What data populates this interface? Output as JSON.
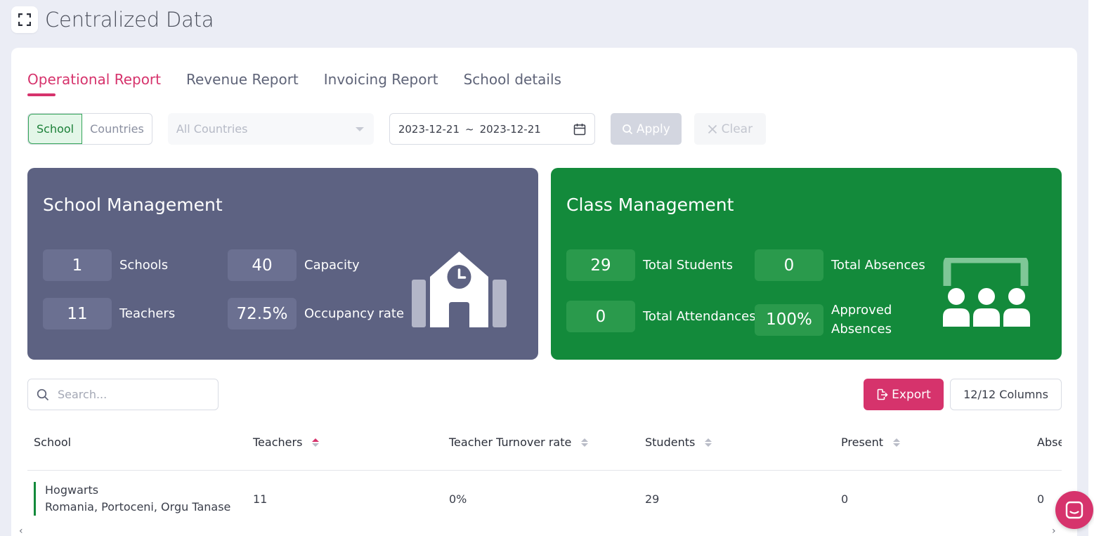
{
  "header": {
    "title": "Centralized Data"
  },
  "tabs": [
    {
      "label": "Operational Report",
      "active": true
    },
    {
      "label": "Revenue Report",
      "active": false
    },
    {
      "label": "Invoicing Report",
      "active": false
    },
    {
      "label": "School details",
      "active": false
    }
  ],
  "filters": {
    "segment": {
      "school": "School",
      "countries": "Countries",
      "selected": "School"
    },
    "country_select": {
      "value": "All Countries"
    },
    "date_range": {
      "start": "2023-12-21",
      "separator": "~",
      "end": "2023-12-21"
    },
    "apply_label": "Apply",
    "clear_label": "Clear"
  },
  "school_management": {
    "title": "School Management",
    "stats": [
      {
        "value": "1",
        "label": "Schools"
      },
      {
        "value": "40",
        "label": "Capacity"
      },
      {
        "value": "11",
        "label": "Teachers"
      },
      {
        "value": "72.5%",
        "label": "Occupancy rate"
      }
    ],
    "icon": "school-building-icon"
  },
  "class_management": {
    "title": "Class Management",
    "stats": [
      {
        "value": "29",
        "label": "Total Students"
      },
      {
        "value": "0",
        "label": "Total Absences"
      },
      {
        "value": "0",
        "label": "Total Attendances"
      },
      {
        "value": "100%",
        "label": "Approved Absences"
      }
    ],
    "icon": "classroom-icon"
  },
  "toolbar": {
    "search_placeholder": "Search...",
    "export_label": "Export",
    "columns_label": "12/12 Columns"
  },
  "table": {
    "headers": [
      "School",
      "Teachers",
      "Teacher Turnover rate",
      "Students",
      "Present",
      "Abse"
    ],
    "rows": [
      {
        "school_name": "Hogwarts",
        "school_location": "Romania, Portoceni, Orgu Tanase",
        "teachers": "11",
        "turnover": "0%",
        "students": "29",
        "present": "0",
        "absent": "0"
      }
    ]
  },
  "colors": {
    "accent": "#d6336c",
    "school_panel": "#5d6282",
    "class_panel": "#138a3b"
  }
}
